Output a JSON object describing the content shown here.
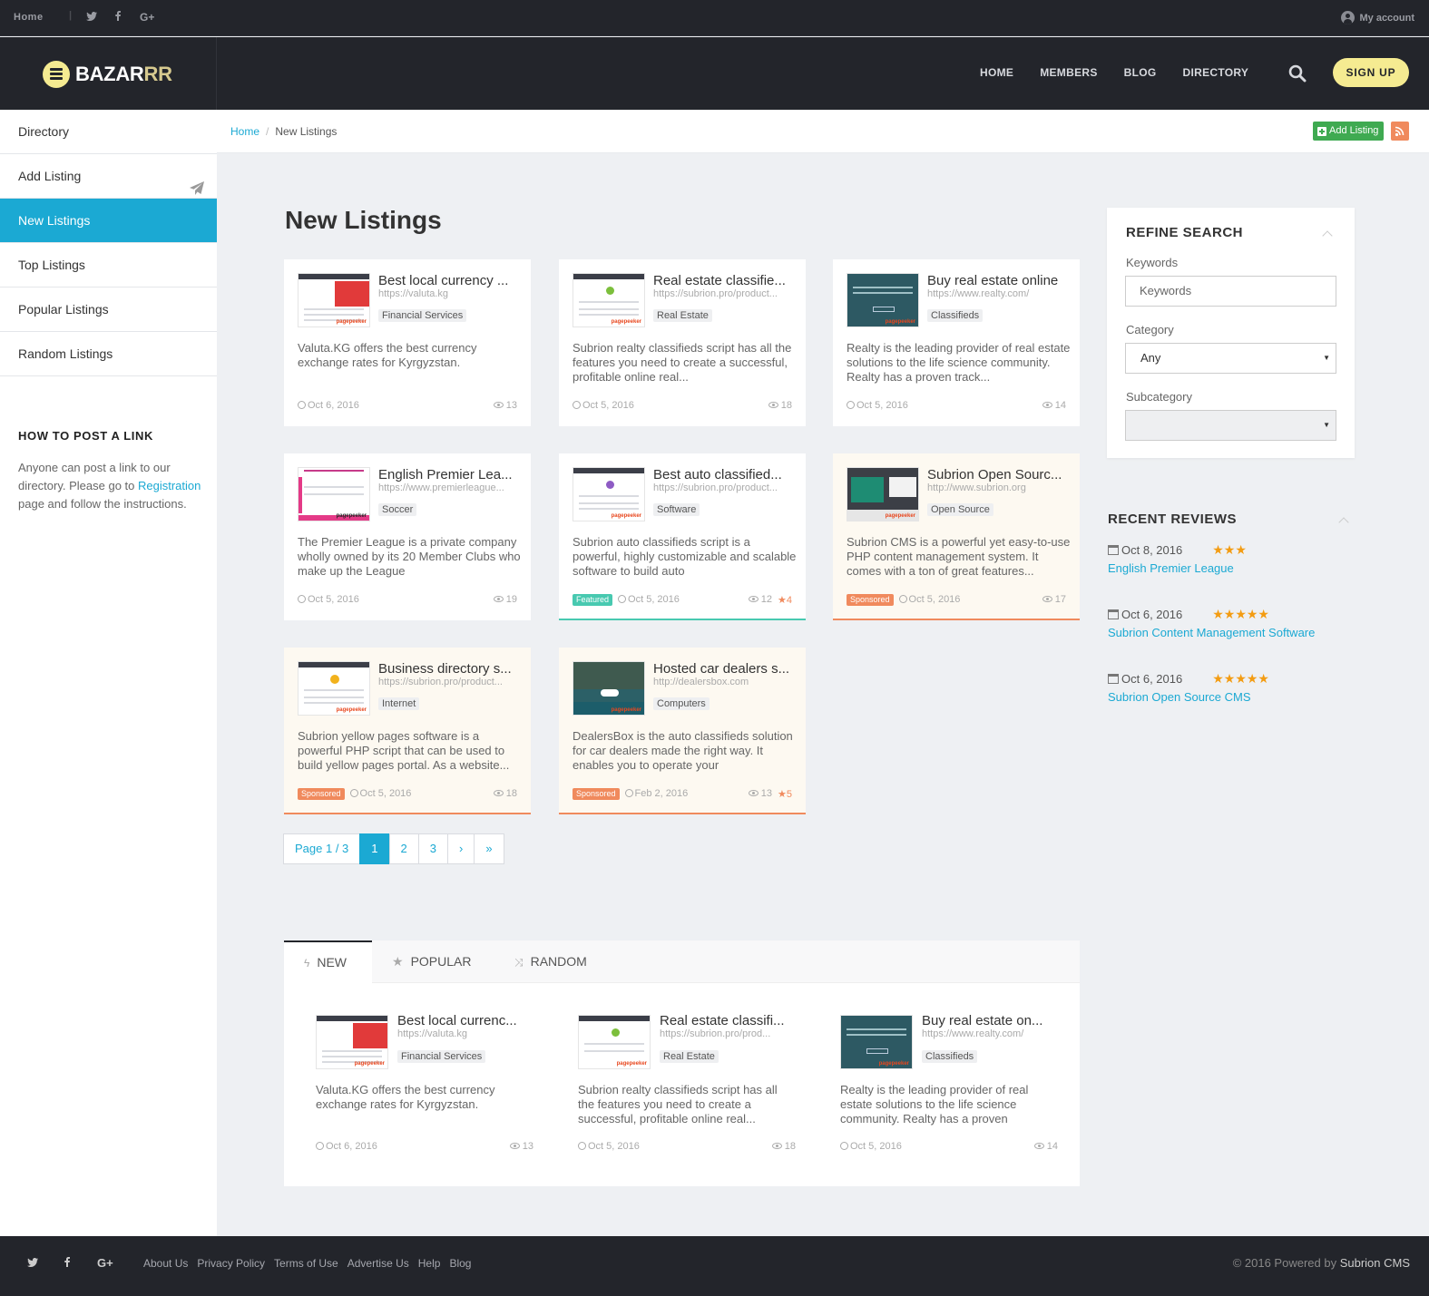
{
  "topbar": {
    "home": "Home",
    "account": "My account",
    "social": [
      "twitter-icon",
      "facebook-icon",
      "google-plus-icon"
    ]
  },
  "logo": {
    "a": "BAZAR",
    "b": "RR"
  },
  "nav": [
    "HOME",
    "MEMBERS",
    "BLOG",
    "DIRECTORY"
  ],
  "signup": "SIGN UP",
  "sidebar": {
    "items": [
      "Directory",
      "Add Listing",
      "New Listings",
      "Top Listings",
      "Popular Listings",
      "Random Listings"
    ],
    "active": 2,
    "howto_title": "HOW TO POST A LINK",
    "howto_p1": "Anyone can post a link to our directory. Please go to ",
    "howto_link": "Registration",
    "howto_p2": " page and follow the instructions."
  },
  "breadcrumb": {
    "home": "Home",
    "sep": "/",
    "current": "New Listings"
  },
  "add_listing": "Add Listing",
  "page_title": "New Listings",
  "listings": [
    {
      "title": "Best local currency ...",
      "url": "https://valuta.kg",
      "category": "Financial Services",
      "desc": "Valuta.KG offers the best currency exchange rates for Kyrgyzstan.",
      "date": "Oct 6, 2016",
      "views": "13",
      "badge": "",
      "rating": ""
    },
    {
      "title": "Real estate classifie...",
      "url": "https://subrion.pro/product...",
      "category": "Real Estate",
      "desc": "Subrion realty classifieds script has all the features you need to create a successful, profitable online real...",
      "date": "Oct 5, 2016",
      "views": "18",
      "badge": "",
      "rating": ""
    },
    {
      "title": "Buy real estate online",
      "url": "https://www.realty.com/",
      "category": "Classifieds",
      "desc": "Realty is the leading provider of real estate solutions to the life science community. Realty has a proven track...",
      "date": "Oct 5, 2016",
      "views": "14",
      "badge": "",
      "rating": ""
    },
    {
      "title": "English Premier Lea...",
      "url": "https://www.premierleague...",
      "category": "Soccer",
      "desc": "The Premier League is a private company wholly owned by its 20 Member Clubs who make up the League",
      "date": "Oct 5, 2016",
      "views": "19",
      "badge": "",
      "rating": ""
    },
    {
      "title": "Best auto classified...",
      "url": "https://subrion.pro/product...",
      "category": "Software",
      "desc": "Subrion auto classifieds script is a powerful, highly customizable and scalable software to build auto",
      "date": "Oct 5, 2016",
      "views": "12",
      "badge": "Featured",
      "rating": "4"
    },
    {
      "title": "Subrion Open Sourc...",
      "url": "http://www.subrion.org",
      "category": "Open Source",
      "desc": "Subrion CMS is a powerful yet easy-to-use PHP content management system. It comes with a ton of great features...",
      "date": "Oct 5, 2016",
      "views": "17",
      "badge": "Sponsored",
      "rating": ""
    },
    {
      "title": "Business directory s...",
      "url": "https://subrion.pro/product...",
      "category": "Internet",
      "desc": "Subrion yellow pages software is a powerful PHP script that can be used to build yellow pages portal. As a website...",
      "date": "Oct 5, 2016",
      "views": "18",
      "badge": "Sponsored",
      "rating": ""
    },
    {
      "title": "Hosted car dealers s...",
      "url": "http://dealersbox.com",
      "category": "Computers",
      "desc": "DealersBox is the auto classifieds solution for car dealers made the right way. It enables you to operate your",
      "date": "Feb 2, 2016",
      "views": "13",
      "badge": "Sponsored",
      "rating": "5"
    }
  ],
  "pagination": {
    "label": "Page 1 / 3",
    "pages": [
      "1",
      "2",
      "3"
    ],
    "next": "›",
    "last": "»"
  },
  "tabs": [
    "NEW",
    "POPULAR",
    "RANDOM"
  ],
  "tab_items": [
    {
      "title": "Best local currenc...",
      "url": "https://valuta.kg",
      "category": "Financial Services",
      "desc": "Valuta.KG offers the best currency exchange rates for Kyrgyzstan.",
      "date": "Oct 6, 2016",
      "views": "13"
    },
    {
      "title": "Real estate classifi...",
      "url": "https://subrion.pro/prod...",
      "category": "Real Estate",
      "desc": "Subrion realty classifieds script has all the features you need to create a successful, profitable online real...",
      "date": "Oct 5, 2016",
      "views": "18"
    },
    {
      "title": "Buy real estate on...",
      "url": "https://www.realty.com/",
      "category": "Classifieds",
      "desc": "Realty is the leading provider of real estate solutions to the life science community. Realty has a proven",
      "date": "Oct 5, 2016",
      "views": "14"
    }
  ],
  "refine": {
    "title": "REFINE SEARCH",
    "keywords_label": "Keywords",
    "keywords_placeholder": "Keywords",
    "category_label": "Category",
    "category_value": "Any",
    "subcategory_label": "Subcategory",
    "subcategory_value": ""
  },
  "reviews": {
    "title": "RECENT REVIEWS",
    "items": [
      {
        "date": "Oct 8, 2016",
        "stars": 3,
        "link": "English Premier League"
      },
      {
        "date": "Oct 6, 2016",
        "stars": 5,
        "link": "Subrion Content Management Software"
      },
      {
        "date": "Oct 6, 2016",
        "stars": 5,
        "link": "Subrion Open Source CMS"
      }
    ]
  },
  "footer": {
    "links": [
      "About Us",
      "Privacy Policy",
      "Terms of Use",
      "Advertise Us",
      "Help",
      "Blog"
    ],
    "copy": "© 2016 Powered by ",
    "brand": "Subrion CMS"
  },
  "colors": {
    "accent": "#1ba9d3",
    "dark": "#23252b",
    "signup": "#f5eb91",
    "sponsored": "#f08a5d",
    "featured": "#48c9b0",
    "star": "#f39c12",
    "add": "#3faa51"
  }
}
